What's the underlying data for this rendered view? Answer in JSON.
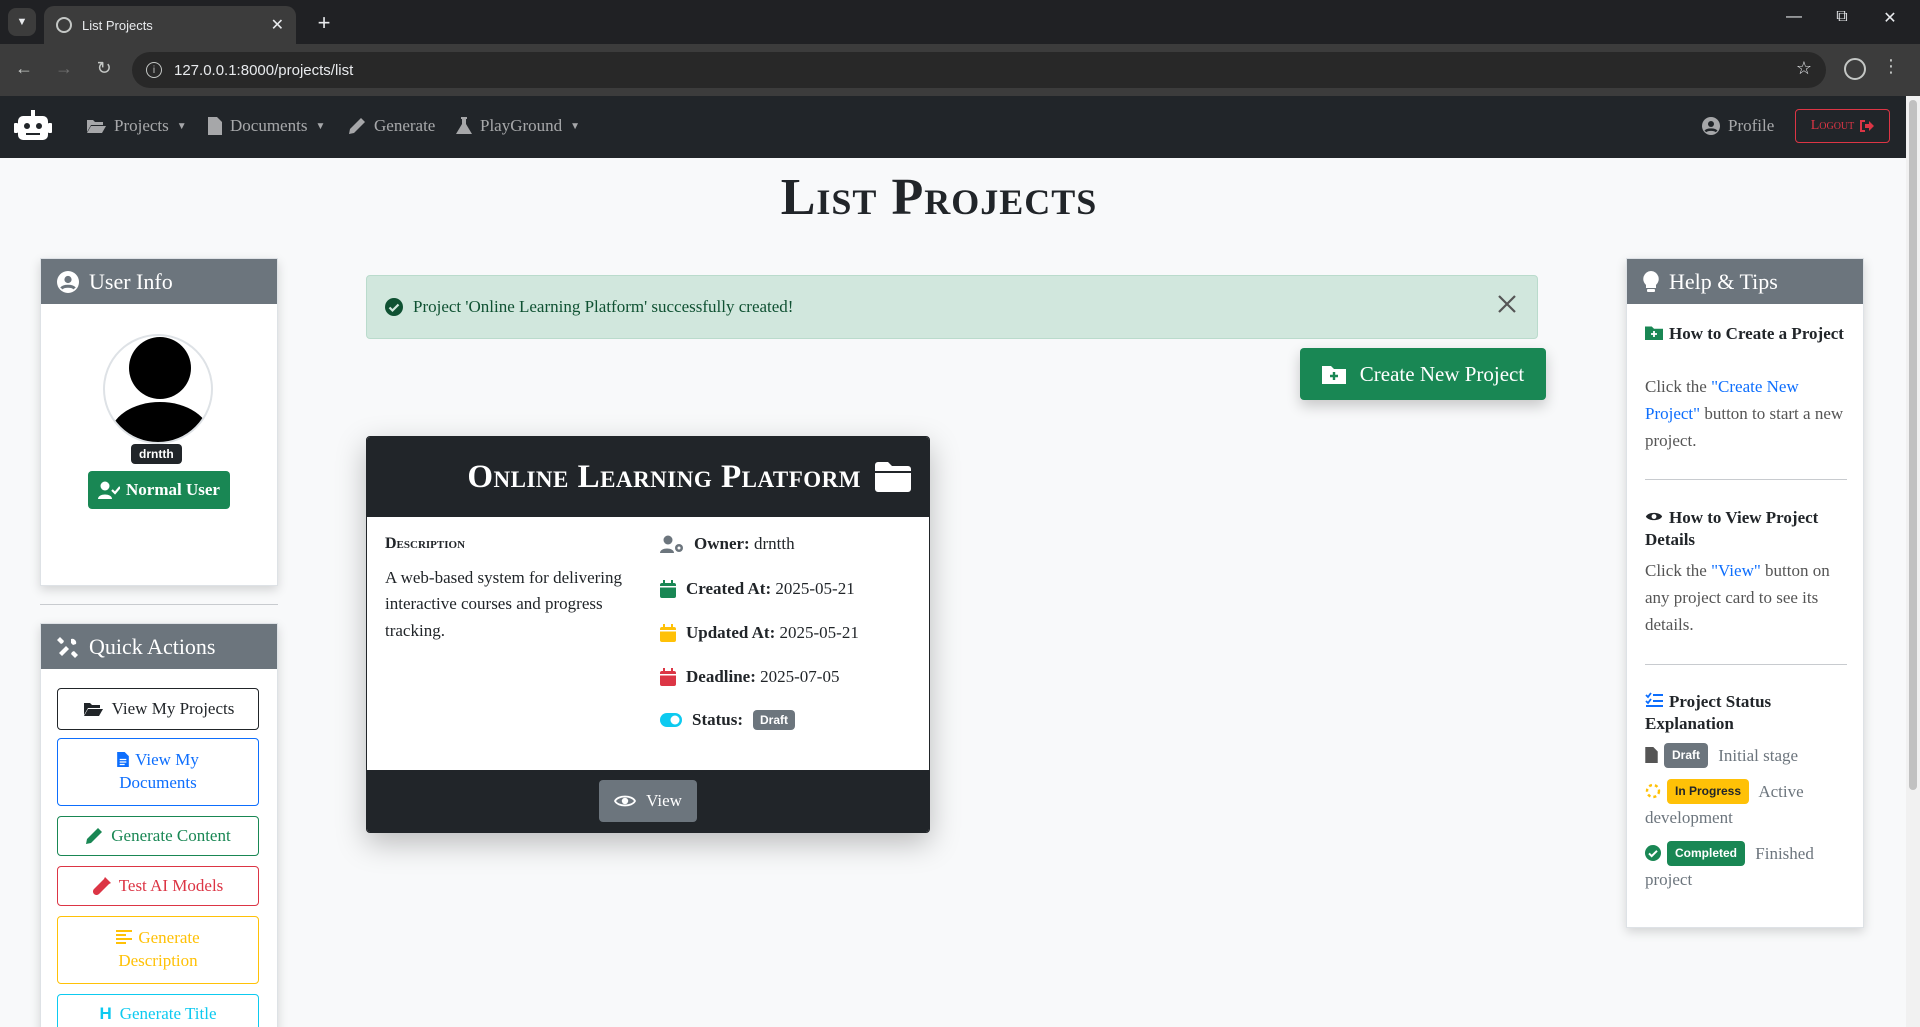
{
  "browser": {
    "tab_title": "List Projects",
    "url": "127.0.0.1:8000/projects/list"
  },
  "navbar": {
    "items": [
      {
        "label": "Projects",
        "icon": "folder-open-icon",
        "dropdown": true
      },
      {
        "label": "Documents",
        "icon": "file-icon",
        "dropdown": true
      },
      {
        "label": "Generate",
        "icon": "pen-icon",
        "dropdown": false
      },
      {
        "label": "PlayGround",
        "icon": "flask-icon",
        "dropdown": true
      }
    ],
    "profile_label": "Profile",
    "logout_label": "Logout"
  },
  "page": {
    "title": "List Projects"
  },
  "user_info": {
    "title": "User Info",
    "username": "drntth",
    "role_label": "Normal User"
  },
  "quick_actions": {
    "title": "Quick Actions",
    "buttons": [
      {
        "label": "View My Projects",
        "color": "#212529"
      },
      {
        "label": "View My Documents",
        "color": "#0d6efd"
      },
      {
        "label": "Generate Content",
        "color": "#198754"
      },
      {
        "label": "Test AI Models",
        "color": "#dc3545"
      },
      {
        "label": "Generate Description",
        "color": "#ffc107"
      },
      {
        "label": "Generate Title",
        "color": "#0dcaf0"
      }
    ]
  },
  "alert": {
    "message": "Project 'Online Learning Platform' successfully created!"
  },
  "create_button_label": "Create New Project",
  "project": {
    "name": "Online Learning Platform",
    "description_label": "Description",
    "description": "A web-based system for delivering interactive courses and progress tracking.",
    "owner_label": "Owner:",
    "owner": "drntth",
    "created_label": "Created At:",
    "created": "2025-05-21",
    "updated_label": "Updated At:",
    "updated": "2025-05-21",
    "deadline_label": "Deadline:",
    "deadline": "2025-07-05",
    "status_label": "Status:",
    "status": "Draft",
    "view_label": "View"
  },
  "help": {
    "title": "Help & Tips",
    "create_title": "How to Create a Project",
    "create_text_pre": "Click the ",
    "create_text_link": "\"Create New Project\"",
    "create_text_post": " button to start a new project.",
    "view_title": "How to View Project Details",
    "view_text_pre": "Click the ",
    "view_text_link": "\"View\"",
    "view_text_post": " button on any project card to see its details.",
    "status_title": "Project Status Explanation",
    "statuses": [
      {
        "badge": "Draft",
        "desc": "Initial stage",
        "color": "#6c757d"
      },
      {
        "badge": "In Progress",
        "desc": "Active development",
        "color": "#ffc107"
      },
      {
        "badge": "Completed",
        "desc": "Finished project",
        "color": "#198754"
      }
    ]
  }
}
